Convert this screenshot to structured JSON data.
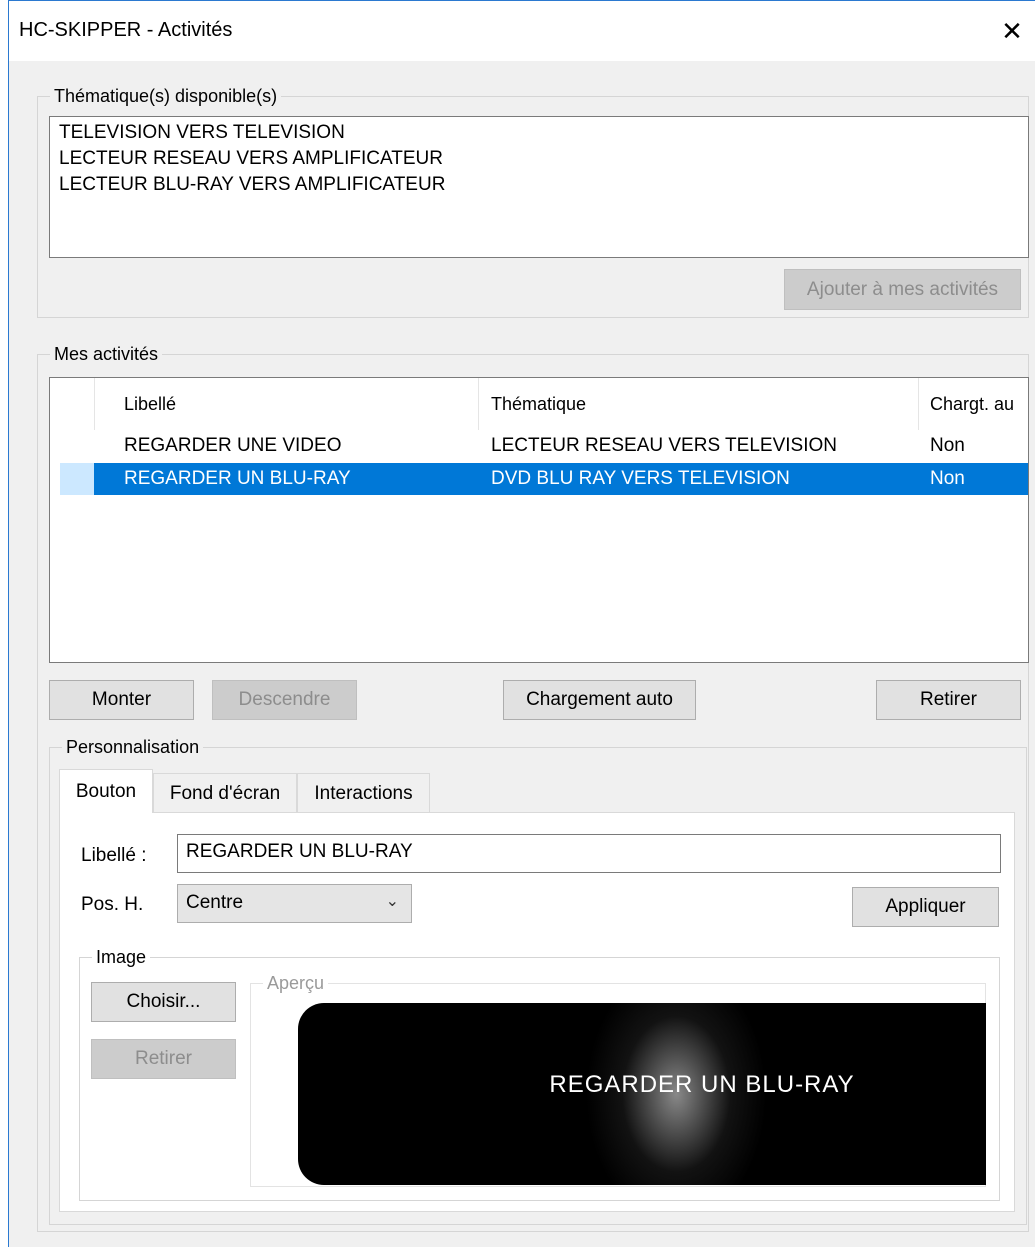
{
  "window": {
    "title": "HC-SKIPPER - Activités",
    "close_glyph": "✕"
  },
  "available": {
    "group_label": "Thématique(s) disponible(s)",
    "items": [
      "TELEVISION VERS TELEVISION",
      "LECTEUR RESEAU VERS AMPLIFICATEUR",
      "LECTEUR BLU-RAY VERS AMPLIFICATEUR"
    ],
    "add_button": "Ajouter à mes activités"
  },
  "activities": {
    "group_label": "Mes activités",
    "columns": [
      "Libellé",
      "Thématique",
      "Chargt. au"
    ],
    "rows": [
      {
        "label": "REGARDER UNE VIDEO",
        "theme": "LECTEUR RESEAU VERS TELEVISION",
        "auto": "Non",
        "selected": false
      },
      {
        "label": "REGARDER UN BLU-RAY",
        "theme": "DVD BLU RAY VERS TELEVISION",
        "auto": "Non",
        "selected": true
      }
    ],
    "buttons": {
      "up": "Monter",
      "down": "Descendre",
      "auto_load": "Chargement auto",
      "remove": "Retirer"
    }
  },
  "custom": {
    "group_label": "Personnalisation",
    "tabs": [
      "Bouton",
      "Fond d'écran",
      "Interactions"
    ],
    "active_tab": "Bouton",
    "label_caption": "Libellé :",
    "label_value": "REGARDER UN BLU-RAY",
    "pos_caption": "Pos. H.",
    "pos_value": "Centre",
    "apply_button": "Appliquer",
    "image_group": "Image",
    "choose_button": "Choisir...",
    "remove_button": "Retirer",
    "preview_group": "Aperçu",
    "preview_text": "REGARDER UN BLU-RAY"
  },
  "colors": {
    "selection": "#0078d7",
    "window_bg": "#f0f0f0",
    "accent_border": "#2b79d0"
  }
}
